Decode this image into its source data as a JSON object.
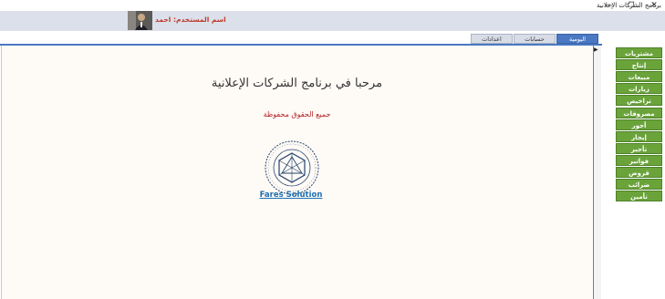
{
  "window": {
    "title": "برنامج الشركات الإعلانية",
    "min_symbol": "—",
    "max_symbol": "❐",
    "close_symbol": "✕"
  },
  "header": {
    "user_label": "اسم المستخدم:",
    "user_name": "احمد"
  },
  "tabs": [
    {
      "label": "اليومية",
      "active": true
    },
    {
      "label": "حسابات",
      "active": false
    },
    {
      "label": "اعدادات",
      "active": false
    }
  ],
  "main": {
    "welcome": "مرحبا في برنامج الشركات الإعلانية",
    "rights": "جميع الحقوق محفوظة",
    "company": "Fares Solution"
  },
  "sidebar": {
    "items": [
      "مشتريات",
      "إنتاج",
      "مبيعات",
      "زيارات",
      "تراخيص",
      "مصروفات",
      "أجور",
      "إيجار",
      "تأجير",
      "فواتير",
      "قروض",
      "ضرائب",
      "تأمين"
    ]
  },
  "colors": {
    "accent": "#4a78c2",
    "sidebar_green": "#6aa33a",
    "rights_red": "#b22222",
    "link_blue": "#1f6fb0"
  }
}
